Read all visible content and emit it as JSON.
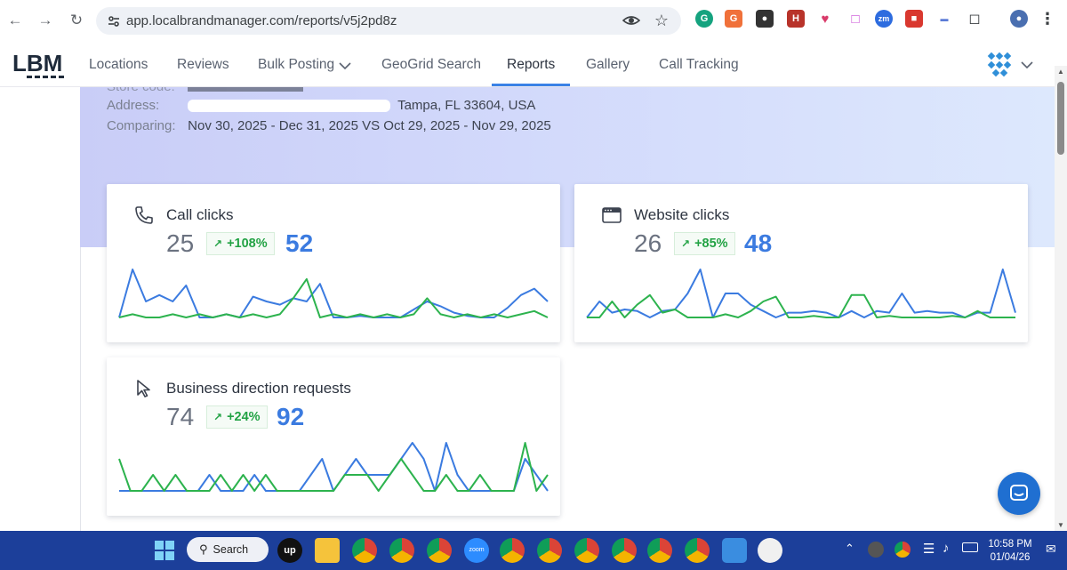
{
  "browser": {
    "url": "app.localbrandmanager.com/reports/v5j2pd8z"
  },
  "app": {
    "logo": "LBM",
    "nav": [
      {
        "label": "Locations"
      },
      {
        "label": "Reviews"
      },
      {
        "label": "Bulk Posting"
      },
      {
        "label": "GeoGrid Search"
      },
      {
        "label": "Reports"
      },
      {
        "label": "Gallery"
      },
      {
        "label": "Call Tracking"
      }
    ],
    "active_nav": "Reports"
  },
  "report": {
    "store_code_partial": "Store code:",
    "address_label": "Address:",
    "address_value": "Tampa, FL 33604, USA",
    "comparing_label": "Comparing:",
    "comparing_value": "Nov 30, 2025 - Dec 31, 2025 VS Oct 29, 2025 - Nov 29, 2025"
  },
  "cards": [
    {
      "title": "Call clicks",
      "icon": "phone-icon",
      "previous": "25",
      "change": "+108%",
      "current": "52"
    },
    {
      "title": "Website clicks",
      "icon": "browser-window-icon",
      "previous": "26",
      "change": "+85%",
      "current": "48"
    },
    {
      "title": "Business direction requests",
      "icon": "cursor-arrow-icon",
      "previous": "74",
      "change": "+24%",
      "current": "92"
    }
  ],
  "colors": {
    "current_series": "#3b7be0",
    "previous_series": "#2db34e",
    "accent": "#3b82e6",
    "taskbar": "#1c3f9a"
  },
  "chart_data": [
    {
      "type": "line",
      "title": "Call clicks",
      "series": [
        {
          "values": [
            0,
            3,
            1,
            1.4,
            1,
            2,
            0,
            0,
            0.2,
            0,
            1.3,
            1,
            0.8,
            1.2,
            1,
            2.1,
            0,
            0,
            0.1,
            0,
            0,
            0,
            0.5,
            1,
            0.7,
            0.3,
            0.1,
            0,
            0,
            0.6,
            1.4,
            1.8,
            1
          ]
        },
        {
          "values": [
            0,
            0.2,
            0,
            0,
            0.2,
            0,
            0.2,
            0,
            0.2,
            0,
            0.2,
            0,
            0.2,
            1.2,
            2.4,
            0,
            0.2,
            0,
            0.2,
            0,
            0.2,
            0,
            0.2,
            1.2,
            0.2,
            0,
            0.2,
            0,
            0.2,
            0,
            0.2,
            0.4,
            0
          ]
        }
      ]
    },
    {
      "type": "line",
      "title": "Website clicks",
      "series": [
        {
          "values": [
            0,
            1,
            0.3,
            0.5,
            0.4,
            0,
            0.4,
            0.5,
            1.5,
            3,
            0,
            1.5,
            1.5,
            0.8,
            0.4,
            0,
            0.3,
            0.3,
            0.4,
            0.3,
            0,
            0.4,
            0,
            0.4,
            0.3,
            1.5,
            0.3,
            0.4,
            0.3,
            0.3,
            0,
            0.3,
            0.3,
            3,
            0.3
          ]
        },
        {
          "values": [
            0,
            0,
            1,
            0,
            0.8,
            1.4,
            0.3,
            0.5,
            0,
            0,
            0,
            0.2,
            0,
            0.4,
            1,
            1.3,
            0,
            0,
            0.1,
            0,
            0,
            1.4,
            1.4,
            0,
            0.1,
            0,
            0,
            0,
            0,
            0.1,
            0,
            0.4,
            0,
            0,
            0
          ]
        }
      ]
    },
    {
      "type": "line",
      "title": "Business direction requests",
      "series": [
        {
          "values": [
            1,
            1,
            1,
            1,
            1,
            1,
            1,
            1,
            2,
            1,
            1,
            1,
            2,
            1,
            1,
            1,
            1,
            2,
            3,
            1,
            2,
            3,
            2,
            2,
            2,
            3,
            4,
            3,
            1,
            4,
            2,
            1,
            1,
            1,
            1,
            1,
            3,
            2,
            1
          ]
        },
        {
          "values": [
            3,
            1,
            1,
            2,
            1,
            2,
            1,
            1,
            1,
            2,
            1,
            2,
            1,
            2,
            1,
            1,
            1,
            1,
            1,
            1,
            2,
            2,
            2,
            1,
            2,
            3,
            2,
            1,
            1,
            2,
            1,
            1,
            2,
            1,
            1,
            1,
            4,
            1,
            2
          ]
        }
      ]
    }
  ],
  "taskbar": {
    "search_label": "Search",
    "time": "10:58 PM",
    "date": "01/04/26"
  }
}
